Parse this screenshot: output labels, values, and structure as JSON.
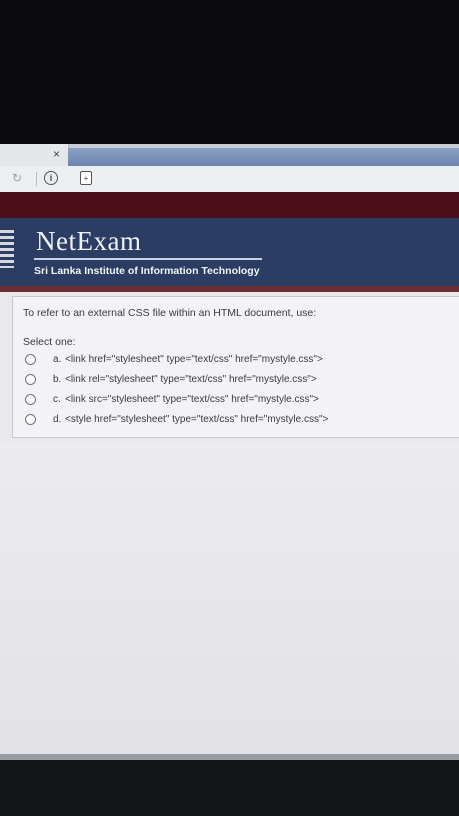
{
  "browser": {
    "tab_close_glyph": "×",
    "reload_glyph": "↻",
    "info_glyph": "i",
    "page_glyph": "+"
  },
  "site": {
    "logo_text": "NetExam",
    "subtitle": "Sri Lanka Institute of Information Technology"
  },
  "question": {
    "text": "To refer to an external CSS file within an HTML document, use:",
    "select_label": "Select one:",
    "options": [
      {
        "letter": "a.",
        "text": "<link href=\"stylesheet\" type=\"text/css\" href=\"mystyle.css\">"
      },
      {
        "letter": "b.",
        "text": "<link rel=\"stylesheet\" type=\"text/css\" href=\"mystyle.css\">"
      },
      {
        "letter": "c.",
        "text": "<link src=\"stylesheet\" type=\"text/css\" href=\"mystyle.css\">"
      },
      {
        "letter": "d.",
        "text": "<style href=\"stylesheet\" type=\"text/css\" href=\"mystyle.css\">"
      }
    ]
  },
  "colors": {
    "header_bg": "#2c3d63",
    "red_band": "#4a0f18",
    "panel_bg": "#f3f3f5"
  }
}
